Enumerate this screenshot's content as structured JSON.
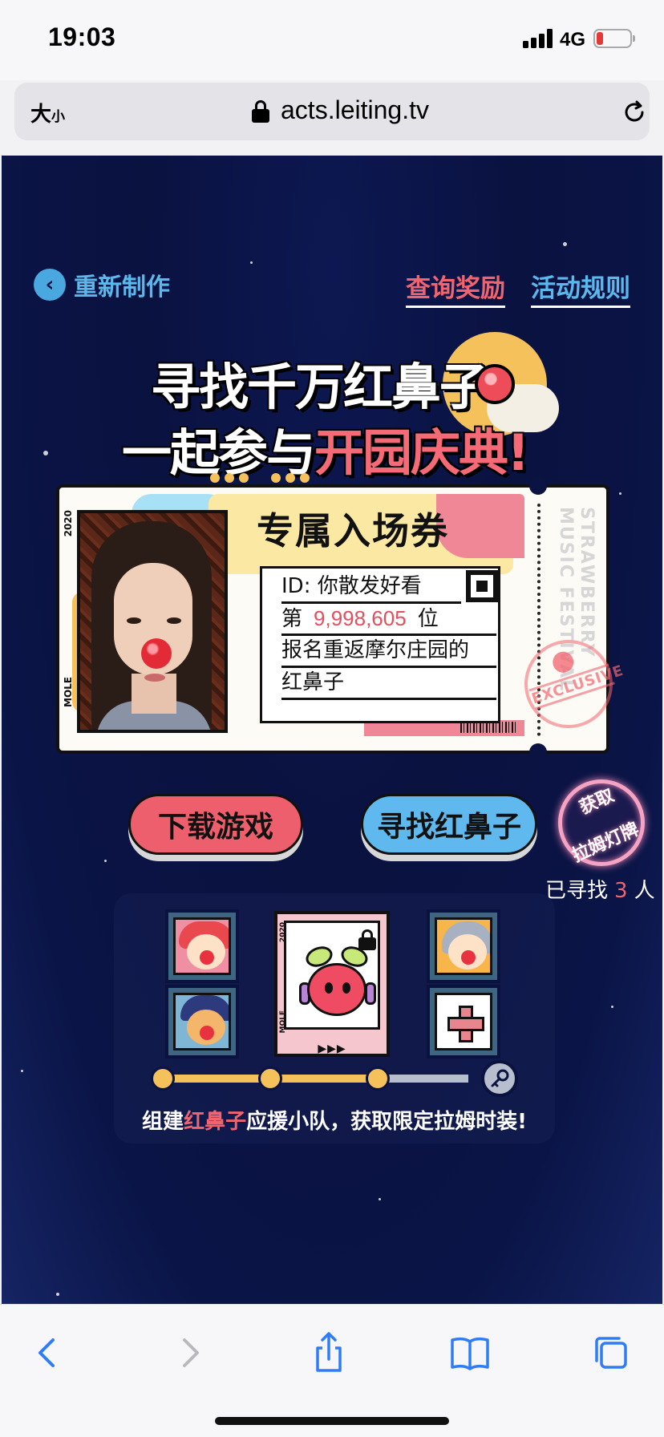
{
  "status_bar": {
    "time": "19:03",
    "network": "4G",
    "battery_level": 0.2,
    "battery_color": "#e53935"
  },
  "url_bar": {
    "text_size_big": "大",
    "text_size_small": "小",
    "domain": "acts.leiting.tv",
    "lock_icon": "lock-icon",
    "reload_icon": "reload-icon"
  },
  "page": {
    "back_label": "重新制作",
    "rewards_link": "查询奖励",
    "rules_link": "活动规则",
    "headline_line1": "寻找千万红鼻子",
    "headline_line2_white": "一起参与",
    "headline_line2_pink": "开园庆典!",
    "ticket": {
      "title": "专属入场券",
      "side_year": "2020",
      "side_brand": "MOLE",
      "id_line": "ID: 你散发好看",
      "rank_prefix": "第",
      "rank_number": "9,998,605",
      "rank_suffix": "位",
      "desc_line1": "报名重返摩尔庄园的",
      "desc_line2": "红鼻子",
      "stub_text": "STRAWBERRY MUSIC FESTIVAL",
      "stamp_text": "EXCLUSIVE"
    },
    "download_button": "下载游戏",
    "find_button": "寻找红鼻子",
    "lantern_button_line1": "获取",
    "lantern_button_line2": "拉姆灯牌",
    "found_prefix": "已寻找",
    "found_count": "3",
    "found_suffix": "人",
    "team": {
      "card_year": "2020",
      "card_brand": "MOLE",
      "card_arrows": "▶▶▶",
      "caption_before": "组建",
      "caption_highlight": "红鼻子",
      "caption_after": "应援小队，获取限定拉姆时装!",
      "progress_filled_fraction": 0.68
    }
  },
  "colors": {
    "accent_pink": "#f0646f",
    "accent_blue": "#5bb8ec",
    "accent_yellow": "#f5c15a",
    "background_navy": "#0a1240"
  }
}
